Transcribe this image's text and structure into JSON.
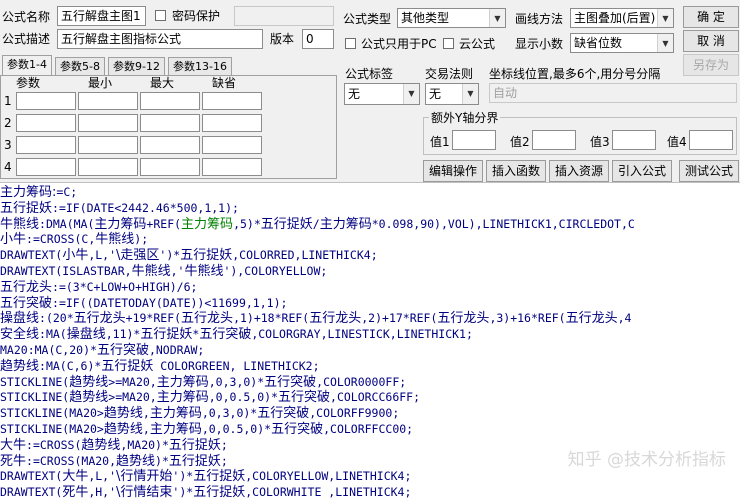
{
  "form": {
    "name_label": "公式名称",
    "name_value": "五行解盘主图1",
    "password_label": "密码保护",
    "desc_label": "公式描述",
    "desc_value": "五行解盘主图指标公式",
    "version_label": "版本",
    "version_value": "0",
    "type_label": "公式类型",
    "type_value": "其他类型",
    "draw_label": "画线方法",
    "draw_value": "主图叠加(后置)",
    "pc_only_label": "公式只用于PC",
    "cloud_label": "云公式",
    "decimals_label": "显示小数",
    "decimals_value": "缺省位数",
    "tag_label": "公式标签",
    "tag_value": "无",
    "trade_label": "交易法则",
    "trade_value": "无",
    "coord_label": "坐标线位置,最多6个,用分号分隔",
    "coord_value": "自动",
    "y_group_label": "额外Y轴分界",
    "y_labels": [
      "值1",
      "值2",
      "值3",
      "值4"
    ]
  },
  "buttons": {
    "ok": "确  定",
    "cancel": "取  消",
    "save_as": "另存为",
    "edit": "编辑操作",
    "insert_func": "插入函数",
    "insert_res": "插入资源",
    "import": "引入公式",
    "test": "测试公式"
  },
  "tabs": [
    "参数1-4",
    "参数5-8",
    "参数9-12",
    "参数13-16"
  ],
  "params": {
    "headers": [
      "参数",
      "最小",
      "最大",
      "缺省"
    ],
    "rows": [
      "1",
      "2",
      "3",
      "4"
    ]
  },
  "code_lines": [
    [
      [
        "主力筹码:",
        "#000080",
        "c"
      ],
      [
        "=C;",
        "#000080",
        ""
      ]
    ],
    [
      [
        "五行捉妖",
        "#000080",
        "c"
      ],
      [
        ":=IF(DATE<2442.46*500,1,1);",
        "#000080",
        ""
      ]
    ],
    [
      [
        "牛熊线",
        "#000080",
        "c"
      ],
      [
        ":DMA(MA(",
        "#000080",
        ""
      ],
      [
        "主力筹码",
        "#000080",
        "c"
      ],
      [
        "+REF(",
        "#000080",
        ""
      ],
      [
        "主力筹码",
        "#008000",
        "c"
      ],
      [
        ",5)*",
        "#000080",
        ""
      ],
      [
        "五行捉妖",
        "#000080",
        "c"
      ],
      [
        "/",
        "#000080",
        ""
      ],
      [
        "主力筹码",
        "#000080",
        "c"
      ],
      [
        "*0.098,90),VOL),LINETHICK1,CIRCLEDOT,C",
        "#000080",
        ""
      ]
    ],
    [
      [
        "小牛",
        "#000080",
        "c"
      ],
      [
        ":=CROSS(C,",
        "#000080",
        ""
      ],
      [
        "牛熊线",
        "#000080",
        "c"
      ],
      [
        ");",
        "#000080",
        ""
      ]
    ],
    [
      [
        "DRAWTEXT(",
        "#000080",
        ""
      ],
      [
        "小牛",
        "#000080",
        "c"
      ],
      [
        ",L,'",
        "#000080",
        ""
      ],
      [
        "\\走强区",
        "#000080",
        "c"
      ],
      [
        "')*",
        "#000080",
        ""
      ],
      [
        "五行捉妖",
        "#000080",
        "c"
      ],
      [
        ",COLORRED,LINETHICK4;",
        "#000080",
        ""
      ]
    ],
    [
      [
        "DRAWTEXT(ISLASTBAR,",
        "#000080",
        ""
      ],
      [
        "牛熊线",
        "#000080",
        "c"
      ],
      [
        ",'",
        "#000080",
        ""
      ],
      [
        "牛熊线",
        "#000080",
        "c"
      ],
      [
        "'),COLORYELLOW;",
        "#000080",
        ""
      ]
    ],
    [
      [
        "五行龙头",
        "#000080",
        "c"
      ],
      [
        ":=(3*C+LOW+O+HIGH)/6;",
        "#000080",
        ""
      ]
    ],
    [
      [
        "五行突破",
        "#000080",
        "c"
      ],
      [
        ":=IF((DATETODAY(DATE))<11699,1,1);",
        "#000080",
        ""
      ]
    ],
    [
      [
        "操盘线",
        "#000080",
        "c"
      ],
      [
        ":(20*",
        "#000080",
        ""
      ],
      [
        "五行龙头",
        "#000080",
        "c"
      ],
      [
        "+19*REF(",
        "#000080",
        ""
      ],
      [
        "五行龙头",
        "#000080",
        "c"
      ],
      [
        ",1)+18*REF(",
        "#000080",
        ""
      ],
      [
        "五行龙头",
        "#000080",
        "c"
      ],
      [
        ",2)+17*REF(",
        "#000080",
        ""
      ],
      [
        "五行龙头",
        "#000080",
        "c"
      ],
      [
        ",3)+16*REF(",
        "#000080",
        ""
      ],
      [
        "五行龙头",
        "#000080",
        "c"
      ],
      [
        ",4",
        "#000080",
        ""
      ]
    ],
    [
      [
        "安全线",
        "#000080",
        "c"
      ],
      [
        ":MA(",
        "#000080",
        ""
      ],
      [
        "操盘线",
        "#000080",
        "c"
      ],
      [
        ",11)*",
        "#000080",
        ""
      ],
      [
        "五行捉妖",
        "#000080",
        "c"
      ],
      [
        "*",
        "#000080",
        ""
      ],
      [
        "五行突破",
        "#000080",
        "c"
      ],
      [
        ",COLORGRAY,LINESTICK,LINETHICK1;",
        "#000080",
        ""
      ]
    ],
    [
      [
        "MA20:MA(C,20)*",
        "#000080",
        ""
      ],
      [
        "五行突破",
        "#000080",
        "c"
      ],
      [
        ",NODRAW;",
        "#000080",
        ""
      ]
    ],
    [
      [
        "趋势线",
        "#000080",
        "c"
      ],
      [
        ":MA(C,6)*",
        "#000080",
        ""
      ],
      [
        "五行捉妖",
        "#000080",
        "c"
      ],
      [
        " COLORGREEN, LINETHICK2;",
        "#000080",
        ""
      ]
    ],
    [
      [
        "STICKLINE(",
        "#000080",
        ""
      ],
      [
        "趋势线",
        "#000080",
        "c"
      ],
      [
        ">=MA20,",
        "#000080",
        ""
      ],
      [
        "主力筹码",
        "#000080",
        "c"
      ],
      [
        ",0,3,0)*",
        "#000080",
        ""
      ],
      [
        "五行突破",
        "#000080",
        "c"
      ],
      [
        ",COLOR0000FF;",
        "#000080",
        ""
      ]
    ],
    [
      [
        "STICKLINE(",
        "#000080",
        ""
      ],
      [
        "趋势线",
        "#000080",
        "c"
      ],
      [
        ">=MA20,",
        "#000080",
        ""
      ],
      [
        "主力筹码",
        "#000080",
        "c"
      ],
      [
        ",0,0.5,0)*",
        "#000080",
        ""
      ],
      [
        "五行突破",
        "#000080",
        "c"
      ],
      [
        ",COLORCC66FF;",
        "#000080",
        ""
      ]
    ],
    [
      [
        "STICKLINE(MA20>",
        "#000080",
        ""
      ],
      [
        "趋势线",
        "#000080",
        "c"
      ],
      [
        ",",
        "#000080",
        ""
      ],
      [
        "主力筹码",
        "#000080",
        "c"
      ],
      [
        ",0,3,0)*",
        "#000080",
        ""
      ],
      [
        "五行突破",
        "#000080",
        "c"
      ],
      [
        ",COLORFF9900;",
        "#000080",
        ""
      ]
    ],
    [
      [
        "STICKLINE(MA20>",
        "#000080",
        ""
      ],
      [
        "趋势线",
        "#000080",
        "c"
      ],
      [
        ",",
        "#000080",
        ""
      ],
      [
        "主力筹码",
        "#000080",
        "c"
      ],
      [
        ",0,0.5,0)*",
        "#000080",
        ""
      ],
      [
        "五行突破",
        "#000080",
        "c"
      ],
      [
        ",COLORFFCC00;",
        "#000080",
        ""
      ]
    ],
    [
      [
        "大牛",
        "#000080",
        "c"
      ],
      [
        ":=CROSS(",
        "#000080",
        ""
      ],
      [
        "趋势线",
        "#000080",
        "c"
      ],
      [
        ",MA20)*",
        "#000080",
        ""
      ],
      [
        "五行捉妖",
        "#000080",
        "c"
      ],
      [
        ";",
        "#000080",
        ""
      ]
    ],
    [
      [
        "死牛",
        "#000080",
        "c"
      ],
      [
        ":=CROSS(MA20,",
        "#000080",
        ""
      ],
      [
        "趋势线",
        "#000080",
        "c"
      ],
      [
        ")*",
        "#000080",
        ""
      ],
      [
        "五行捉妖",
        "#000080",
        "c"
      ],
      [
        ";",
        "#000080",
        ""
      ]
    ],
    [
      [
        "DRAWTEXT(",
        "#000080",
        ""
      ],
      [
        "大牛",
        "#000080",
        "c"
      ],
      [
        ",L,'",
        "#000080",
        ""
      ],
      [
        "\\行情开始",
        "#000080",
        "c"
      ],
      [
        "')*",
        "#000080",
        ""
      ],
      [
        "五行捉妖",
        "#000080",
        "c"
      ],
      [
        ",COLORYELLOW,LINETHICK4;",
        "#000080",
        ""
      ]
    ],
    [
      [
        "DRAWTEXT(",
        "#000080",
        ""
      ],
      [
        "死牛",
        "#000080",
        "c"
      ],
      [
        ",H,'",
        "#000080",
        ""
      ],
      [
        "\\行情结束",
        "#000080",
        "c"
      ],
      [
        "')*",
        "#000080",
        ""
      ],
      [
        "五行捉妖",
        "#000080",
        "c"
      ],
      [
        ",COLORWHITE ,LINETHICK4;",
        "#000080",
        ""
      ]
    ]
  ],
  "watermark": "知乎 @技术分析指标"
}
